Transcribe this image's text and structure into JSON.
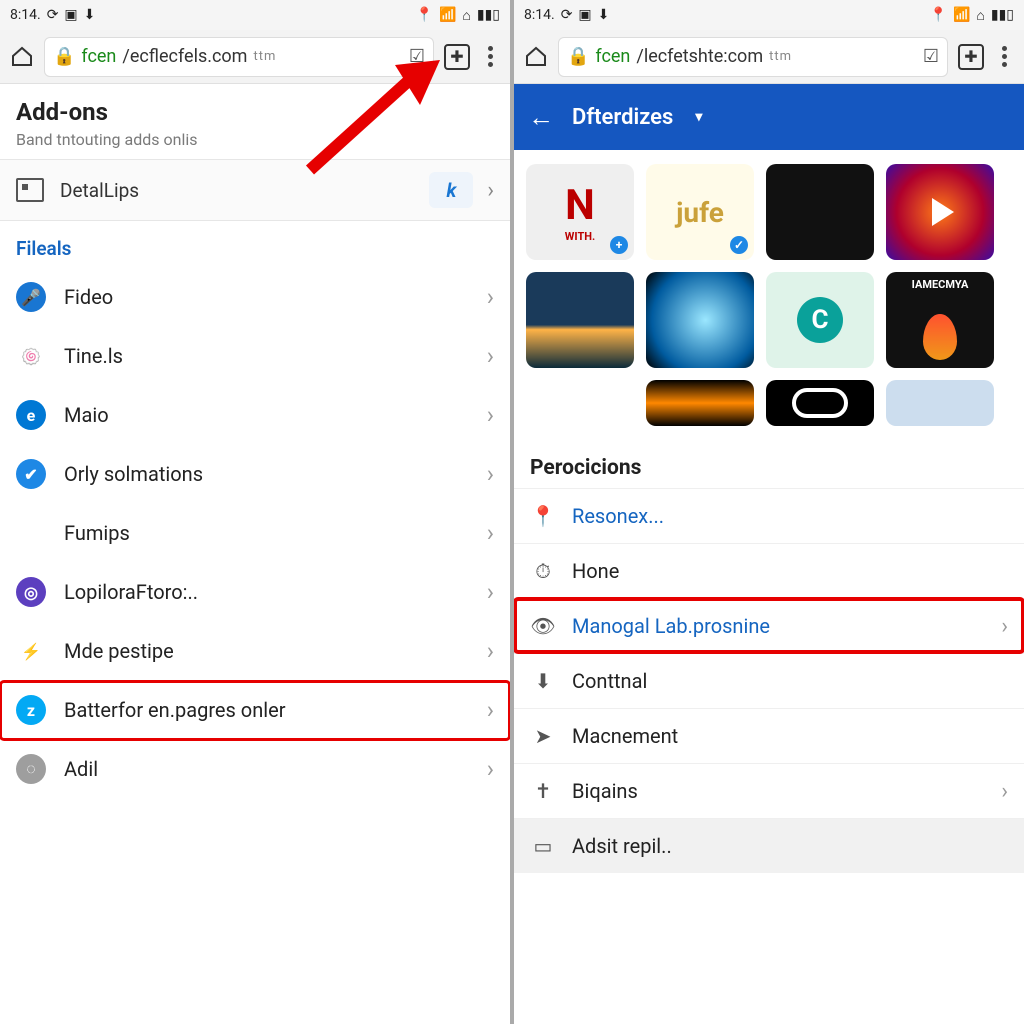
{
  "status": {
    "time": "8:14.",
    "icons": [
      "location",
      "wifi",
      "home",
      "signal"
    ]
  },
  "leftPhone": {
    "url": {
      "domain": "fcen",
      "rest": "/ecflecfels.com",
      "suffix": "ttm"
    },
    "addons": {
      "title": "Add-ons",
      "subtitle": "Band tntouting adds onlis"
    },
    "detail": {
      "label": "DetalLips",
      "ext_icon": "k"
    },
    "group": "Fileals",
    "items": [
      {
        "label": "Fideo",
        "icon": "ic-mic",
        "glyph": "🎤"
      },
      {
        "label": "Tine.ls",
        "icon": "ic-col",
        "glyph": "🍥"
      },
      {
        "label": "Maio",
        "icon": "ic-edge",
        "glyph": "e"
      },
      {
        "label": "Orly solmations",
        "icon": "ic-check",
        "glyph": "✔"
      },
      {
        "label": "Fumips",
        "icon": "ic-chr",
        "glyph": "◐"
      },
      {
        "label": "LopiloraFtoro:..",
        "icon": "ic-pur",
        "glyph": "◎"
      },
      {
        "label": "Mde pestipe",
        "icon": "ic-bolt",
        "glyph": "⚡"
      },
      {
        "label": "Batterfor en.pagres onler",
        "icon": "ic-z",
        "glyph": "z",
        "hl": true
      },
      {
        "label": "Adil",
        "icon": "ic-grey",
        "glyph": "◌"
      }
    ]
  },
  "rightPhone": {
    "url": {
      "domain": "fcen",
      "rest": "/lecfetshte:com",
      "suffix": "ttm"
    },
    "bar_title": "Dfterdizes",
    "thumbs": [
      [
        "N WITH.",
        "jufe",
        "",
        ""
      ],
      [
        "",
        "",
        "",
        "IAMECMYA"
      ],
      [
        "",
        "",
        "",
        ""
      ]
    ],
    "section": "Perocicions",
    "items": [
      {
        "label": "Resonex...",
        "link": true,
        "glyph": "📍"
      },
      {
        "label": "Hone",
        "glyph": "⏱"
      },
      {
        "label": "Manogal Lab.prosnine",
        "link": true,
        "hl": true,
        "chev": true,
        "glyph": "👁"
      },
      {
        "label": "Conttnal",
        "glyph": "⬇"
      },
      {
        "label": "Macnement",
        "glyph": "➤"
      },
      {
        "label": "Biqains",
        "chev": true,
        "glyph": "✝"
      },
      {
        "label": "Adsit repil..",
        "shade": true,
        "glyph": "▭"
      }
    ]
  }
}
